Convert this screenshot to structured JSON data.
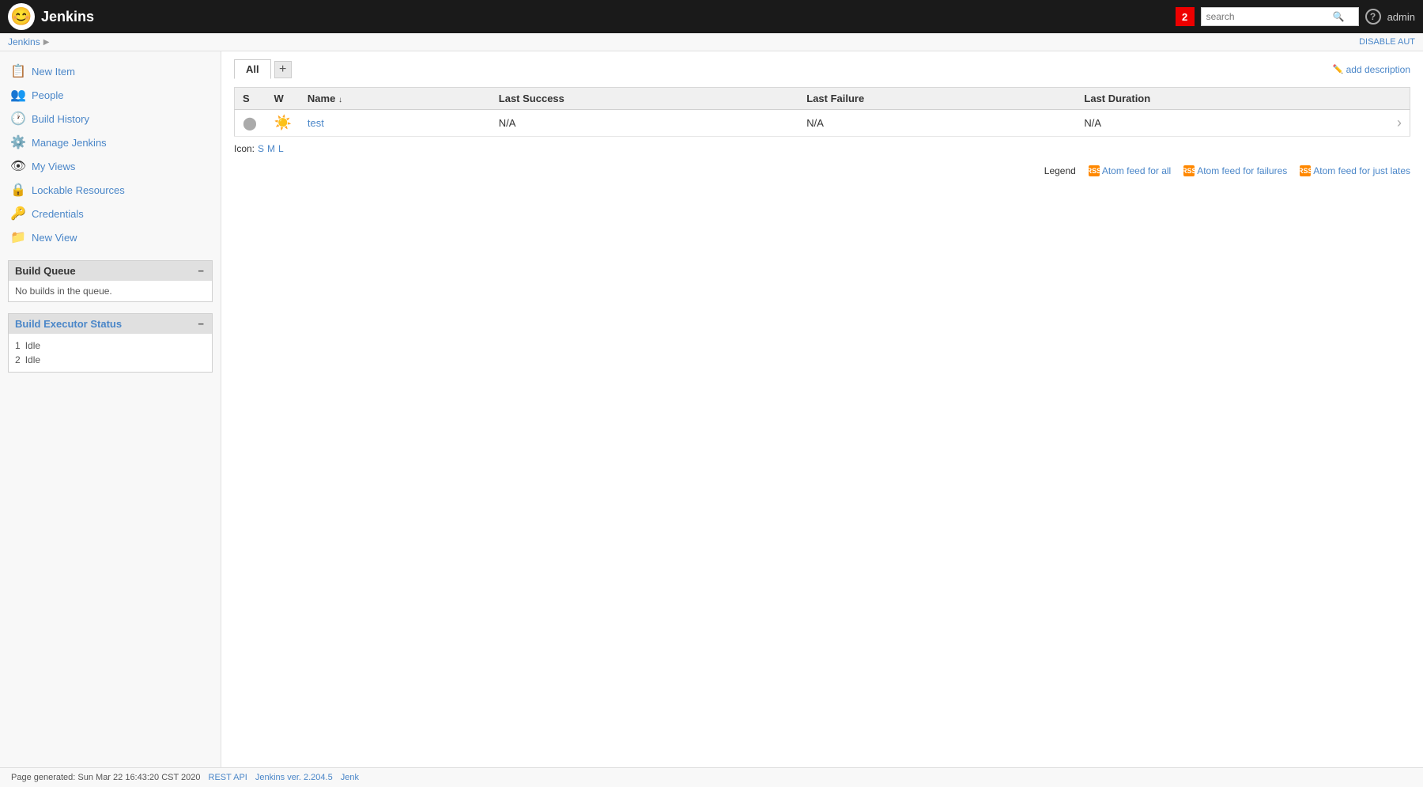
{
  "header": {
    "logo_text": "Jenkins",
    "logo_icon": "👷",
    "notification_count": "2",
    "search_placeholder": "search",
    "help_icon": "?",
    "admin_label": "admin"
  },
  "breadcrumb": {
    "root": "Jenkins",
    "disable_label": "DISABLE AUT"
  },
  "sidebar": {
    "items": [
      {
        "id": "new-item",
        "label": "New Item",
        "icon": "📋"
      },
      {
        "id": "people",
        "label": "People",
        "icon": "👥"
      },
      {
        "id": "build-history",
        "label": "Build History",
        "icon": "🕐"
      },
      {
        "id": "manage-jenkins",
        "label": "Manage Jenkins",
        "icon": "⚙️"
      },
      {
        "id": "my-views",
        "label": "My Views",
        "icon": "👁"
      },
      {
        "id": "lockable-resources",
        "label": "Lockable Resources",
        "icon": "🔒"
      },
      {
        "id": "credentials",
        "label": "Credentials",
        "icon": "🔑"
      },
      {
        "id": "new-view",
        "label": "New View",
        "icon": "📁"
      }
    ],
    "build_queue": {
      "title": "Build Queue",
      "empty_text": "No builds in the queue."
    },
    "build_executor": {
      "title": "Build Executor Status",
      "executors": [
        {
          "number": "1",
          "status": "Idle"
        },
        {
          "number": "2",
          "status": "Idle"
        }
      ]
    }
  },
  "content": {
    "tabs": [
      {
        "id": "all",
        "label": "All",
        "active": true
      }
    ],
    "add_tab_icon": "+",
    "add_description_label": "add description",
    "table": {
      "columns": [
        {
          "id": "s",
          "label": "S",
          "sortable": false
        },
        {
          "id": "w",
          "label": "W",
          "sortable": false
        },
        {
          "id": "name",
          "label": "Name",
          "sortable": true,
          "sort_arrow": "↓"
        },
        {
          "id": "last-success",
          "label": "Last Success",
          "sortable": false
        },
        {
          "id": "last-failure",
          "label": "Last Failure",
          "sortable": false
        },
        {
          "id": "last-duration",
          "label": "Last Duration",
          "sortable": false
        }
      ],
      "rows": [
        {
          "s_status": "grey",
          "w_status": "yellow",
          "name": "test",
          "name_href": "#",
          "last_success": "N/A",
          "last_failure": "N/A",
          "last_duration": "N/A"
        }
      ]
    },
    "icon_size": {
      "label": "Icon:",
      "sizes": [
        "S",
        "M",
        "L"
      ]
    },
    "feeds": {
      "legend_label": "Legend",
      "feed_all_label": "Atom feed for all",
      "feed_failures_label": "Atom feed for failures",
      "feed_latest_label": "Atom feed for just lates"
    }
  },
  "footer": {
    "page_generated": "Page generated: Sun Mar 22 16:43:20 CST 2020",
    "rest_api_label": "REST API",
    "version_label": "Jenkins ver. 2.204.5",
    "jenkins_label": "Jenk"
  }
}
